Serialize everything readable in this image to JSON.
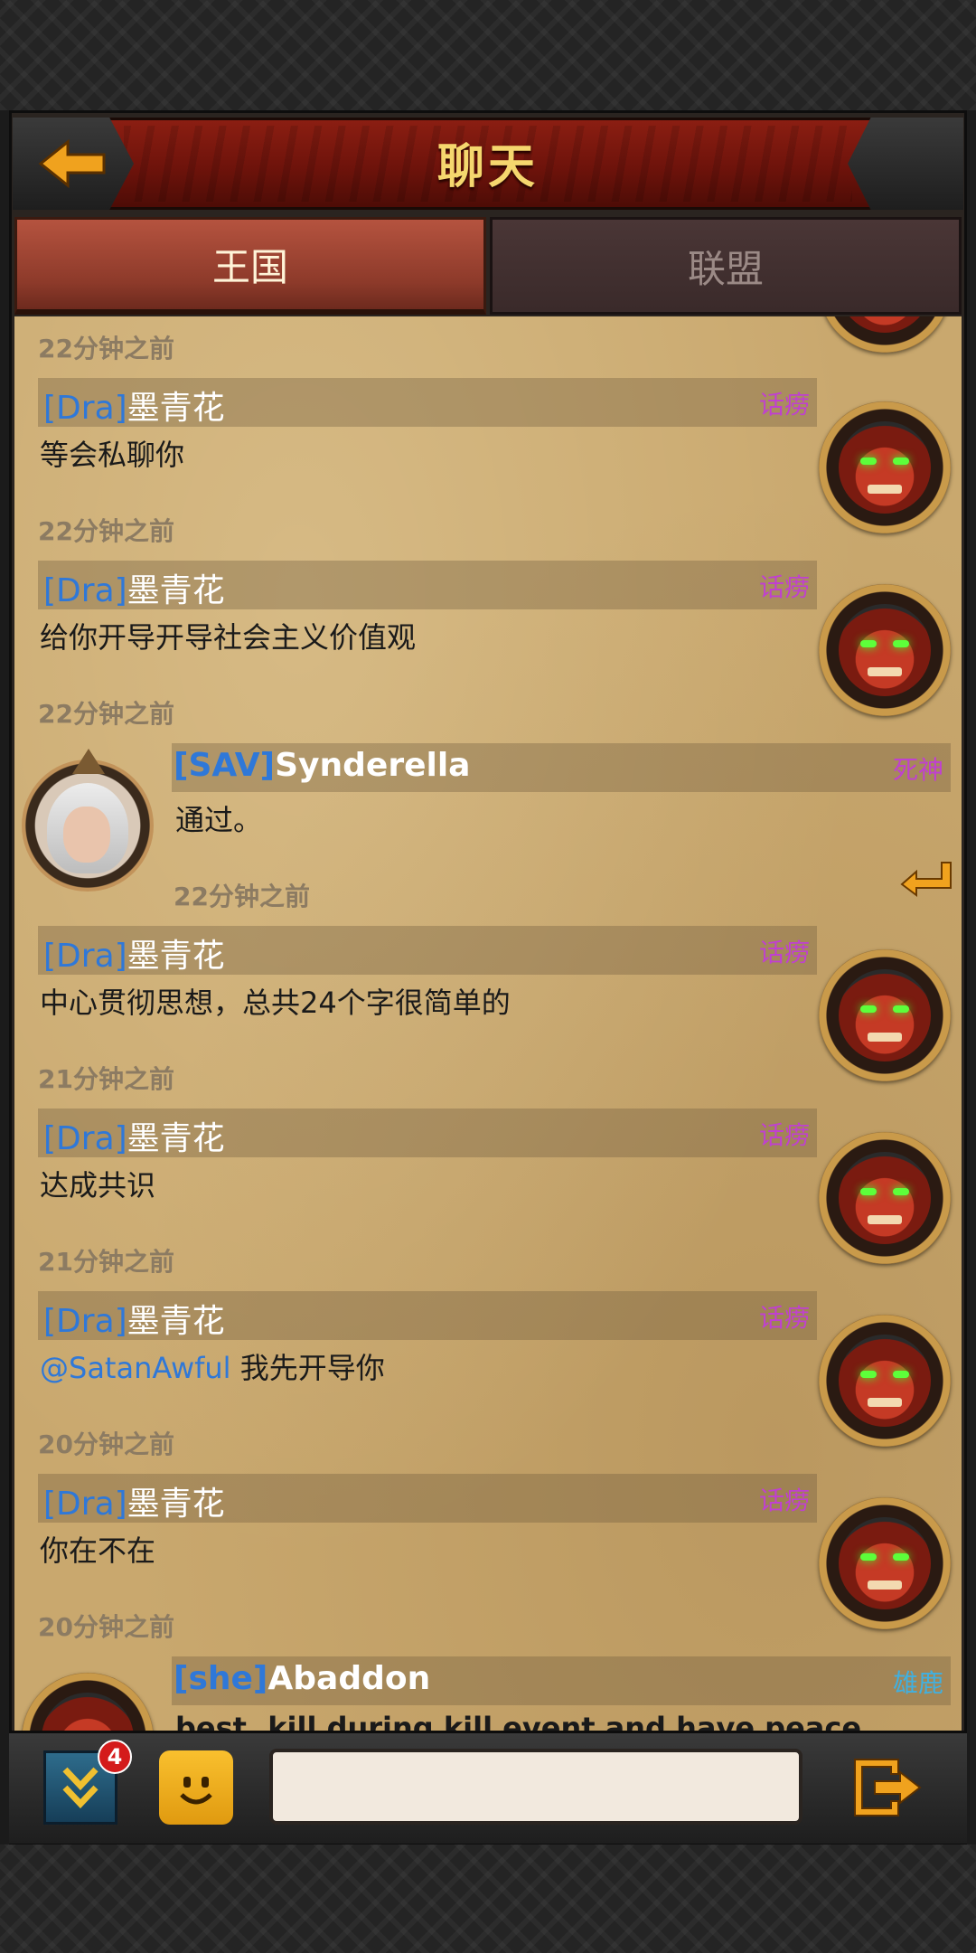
{
  "header": {
    "title": "聊天",
    "back_icon": "arrow-left-icon"
  },
  "tabs": [
    {
      "label": "王国",
      "active": true
    },
    {
      "label": "联盟",
      "active": false
    }
  ],
  "messages": [
    {
      "time": "22分钟之前",
      "tag": "[Dra]",
      "name": "墨青花",
      "rank": "话痨",
      "text": "等会私聊你"
    },
    {
      "time": "22分钟之前",
      "tag": "[Dra]",
      "name": "墨青花",
      "rank": "话痨",
      "text": "给你开导开导社会主义价值观"
    },
    {
      "time": "22分钟之前",
      "tag": "[SAV]",
      "name": "Synderella",
      "rank": "死神",
      "text": "通过。"
    },
    {
      "time": "22分钟之前",
      "tag": "[Dra]",
      "name": "墨青花",
      "rank": "话痨",
      "text": "中心贯彻思想，总共24个字很简单的"
    },
    {
      "time": "21分钟之前",
      "tag": "[Dra]",
      "name": "墨青花",
      "rank": "话痨",
      "text": "达成共识"
    },
    {
      "time": "21分钟之前",
      "tag": "[Dra]",
      "name": "墨青花",
      "rank": "话痨",
      "mention": "@SatanAwful",
      "text": "我先开导你"
    },
    {
      "time": "20分钟之前",
      "tag": "[Dra]",
      "name": "墨青花",
      "rank": "话痨",
      "text": "你在不在"
    },
    {
      "time": "20分钟之前",
      "tag": "[she]",
      "name": "Abaddon",
      "rank": "雄鹿",
      "text": "best. kill during kill event and have peace"
    }
  ],
  "toolbar": {
    "badge_count": "4",
    "input_value": "",
    "input_placeholder": ""
  },
  "colors": {
    "tag_blue": "#2f78d8",
    "rank_purple": "#c040d0",
    "rank_cyan": "#40b0e0",
    "title_gold": "#f5d76e"
  }
}
